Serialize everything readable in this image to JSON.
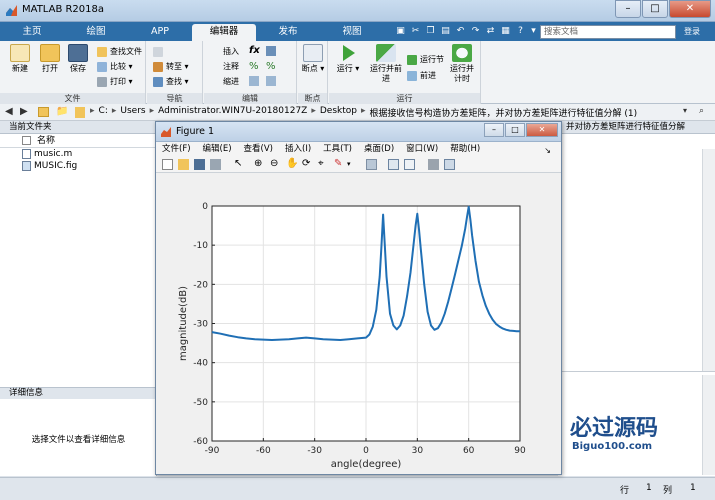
{
  "window": {
    "title": "MATLAB R2018a"
  },
  "tabs": [
    "主页",
    "绘图",
    "APP",
    "编辑器",
    "发布",
    "视图"
  ],
  "active_tab": "编辑器",
  "search": {
    "placeholder": "搜索文档"
  },
  "collapse_label": "登录",
  "ribbon": {
    "file_group": {
      "label": "文件",
      "new": "新建",
      "open": "打开",
      "save": "保存",
      "find_files": "查找文件",
      "compare": "比较",
      "print": "打印"
    },
    "nav_group": {
      "label": "导航",
      "goto": "转至",
      "find": "查找"
    },
    "edit_group": {
      "label": "编辑",
      "insert": "插入",
      "comment": "注释",
      "indent": "缩进",
      "fx": "fx"
    },
    "breakpoint_group": {
      "label": "断点",
      "breakpoints": "断点"
    },
    "run_group": {
      "label": "运行",
      "run": "运行",
      "run_advance": "运行并前进",
      "run_section": "运行节",
      "advance": "前进",
      "run_time": "运行并计时"
    }
  },
  "address": {
    "crumbs": [
      "C:",
      "Users",
      "Administrator.WIN7U-20180127Z",
      "Desktop",
      "根据接收信号构造协方差矩阵，并对协方差矩阵进行特征值分解 (1)"
    ]
  },
  "left_pane": {
    "title": "当前文件夹",
    "column_header": "名称",
    "files": [
      {
        "name": "music.m",
        "icon": "m-file-icon"
      },
      {
        "name": "MUSIC.fig",
        "icon": "fig-file-icon"
      }
    ],
    "detail_title": "详细信息",
    "detail_message": "选择文件以查看详细信息"
  },
  "right_pane": {
    "title": "并对协方差矩阵进行特征值分解"
  },
  "statusbar": {
    "row_label": "行",
    "row": "1",
    "col_label": "列",
    "col": "1"
  },
  "watermark": {
    "text": "必过源码",
    "sub": "Biguo100.com"
  },
  "figure": {
    "title": "Figure 1",
    "menu": [
      "文件(F)",
      "编辑(E)",
      "查看(V)",
      "插入(I)",
      "工具(T)",
      "桌面(D)",
      "窗口(W)",
      "帮助(H)"
    ],
    "line_color": "#1f6fb5"
  },
  "chart_data": {
    "type": "line",
    "title": "",
    "xlabel": "angle(degree)",
    "ylabel": "magnitude(dB)",
    "xlim": [
      -90,
      90
    ],
    "ylim": [
      -60,
      0
    ],
    "xticks": [
      -90,
      -60,
      -30,
      0,
      30,
      60,
      90
    ],
    "yticks": [
      0,
      -10,
      -20,
      -30,
      -40,
      -50,
      -60
    ],
    "grid": true,
    "series": [
      {
        "x": [
          -90,
          -85,
          -80,
          -75,
          -70,
          -65,
          -60,
          -55,
          -50,
          -45,
          -40,
          -35,
          -30,
          -25,
          -20,
          -15,
          -10,
          -5,
          0,
          2,
          4,
          6,
          8,
          9,
          10,
          11,
          12,
          14,
          16,
          18,
          20,
          22,
          24,
          26,
          28,
          29,
          30,
          31,
          32,
          34,
          36,
          38,
          40,
          42,
          44,
          46,
          48,
          50,
          52,
          54,
          56,
          58,
          59,
          60,
          61,
          62,
          64,
          66,
          68,
          70,
          72,
          74,
          76,
          78,
          80,
          82,
          84,
          86,
          88,
          90
        ],
        "y": [
          -32.2,
          -32.6,
          -33.1,
          -33.5,
          -33.8,
          -34,
          -34.1,
          -34.2,
          -34.1,
          -34,
          -33.8,
          -33.6,
          -33.8,
          -34,
          -34.1,
          -34.2,
          -34,
          -33.8,
          -33.6,
          -32.8,
          -30.8,
          -26.5,
          -18,
          -10.5,
          -2.2,
          -10,
          -18,
          -27.5,
          -30.5,
          -31.5,
          -30.5,
          -28,
          -23,
          -17,
          -9,
          -5,
          -2,
          -6,
          -11,
          -20,
          -27,
          -30.5,
          -31.6,
          -31.2,
          -29.8,
          -27.5,
          -24.5,
          -21,
          -17.5,
          -13.8,
          -10.2,
          -5.8,
          -2.8,
          -0.2,
          -3.5,
          -7.5,
          -14,
          -19.3,
          -22.8,
          -25.5,
          -27.5,
          -29,
          -30.1,
          -30.8,
          -31.3,
          -31.6,
          -31.8,
          -31.9,
          -32,
          -32
        ]
      }
    ]
  }
}
